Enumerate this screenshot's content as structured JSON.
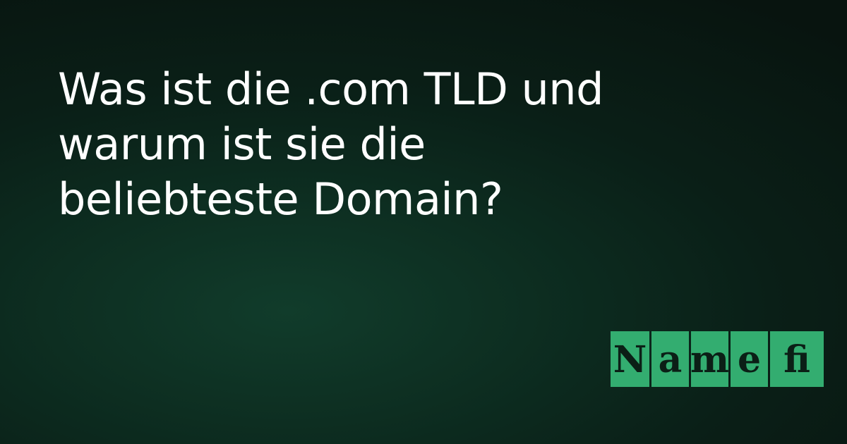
{
  "headline": {
    "lines": [
      "Was ist die .com TLD und",
      "warum ist sie die",
      "beliebteste Domain?"
    ]
  },
  "logo": {
    "text": "Namefi",
    "tiles": [
      "N",
      "a",
      "m",
      "e",
      "fi"
    ],
    "tile_color": "#33ad70",
    "letter_color": "#0b1f16"
  },
  "colors": {
    "background": "#0b2419",
    "background_glow": "#113c2b",
    "text": "#ffffff"
  }
}
